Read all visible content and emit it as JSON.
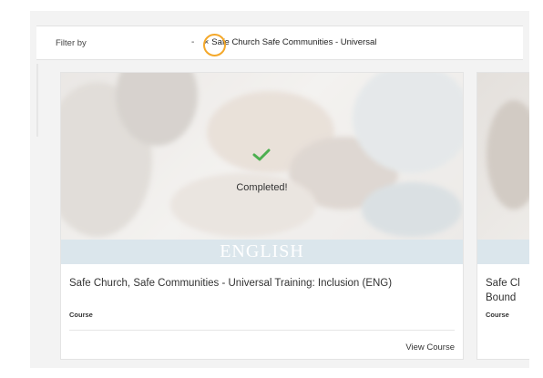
{
  "filter": {
    "label": "Filter by",
    "dash": "-",
    "remove_symbol": "×",
    "chip_text": "Safe Church Safe Communities - Universal"
  },
  "cards": [
    {
      "thumbnail_band": "ENGLISH",
      "status_icon": "check-icon",
      "status_text": "Completed!",
      "title": "Safe Church, Safe Communities - Universal Training: Inclusion (ENG)",
      "type": "Course",
      "action": "View Course"
    },
    {
      "title": "Safe Cl Bound",
      "type": "Course"
    }
  ],
  "colors": {
    "highlight_ring": "#f4a82a",
    "check": "#4caf50",
    "band": "#dbe6ec"
  }
}
